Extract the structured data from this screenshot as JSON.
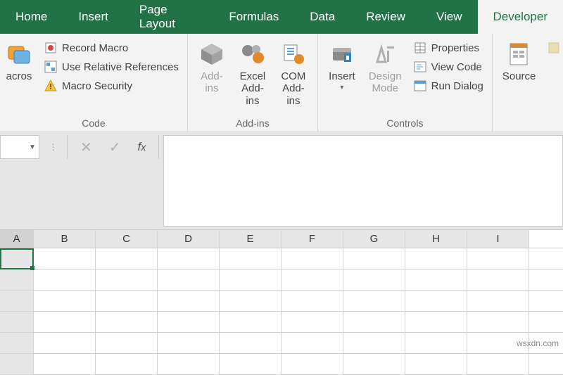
{
  "tabs": {
    "home": "Home",
    "insert": "Insert",
    "pagelayout": "Page Layout",
    "formulas": "Formulas",
    "data": "Data",
    "review": "Review",
    "view": "View",
    "developer": "Developer"
  },
  "ribbon": {
    "code": {
      "basic_sub": "acros",
      "record_macro": "Record Macro",
      "use_relative": "Use Relative References",
      "macro_security": "Macro Security",
      "group_label": "Code"
    },
    "addins": {
      "addins": "Add-\nins",
      "excel_addins": "Excel\nAdd-ins",
      "com_addins": "COM\nAdd-ins",
      "group_label": "Add-ins"
    },
    "controls": {
      "insert": "Insert",
      "design_mode": "Design\nMode",
      "properties": "Properties",
      "view_code": "View Code",
      "run_dialog": "Run Dialog",
      "group_label": "Controls"
    },
    "xml": {
      "source": "Source"
    }
  },
  "columns": [
    "A",
    "B",
    "C",
    "D",
    "E",
    "F",
    "G",
    "H",
    "I"
  ],
  "watermark": "wsxdn.com"
}
